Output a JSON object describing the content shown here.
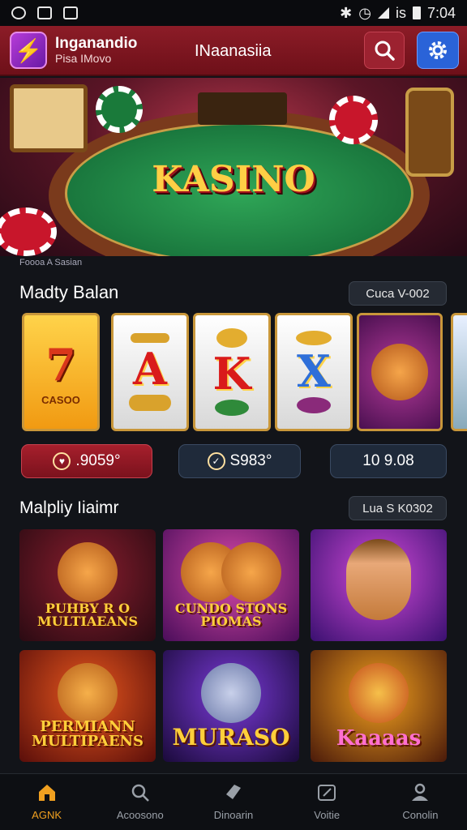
{
  "status_bar": {
    "time": "7:04",
    "network": "is"
  },
  "header": {
    "brand_line1": "Inganandio",
    "brand_line2": "Pisa IMovo",
    "title": "INaanasiia"
  },
  "hero": {
    "word": "KASINO",
    "caption": "Foooa A Sasian"
  },
  "section1": {
    "title": "Madty Balan",
    "pill": "Cuca V-002",
    "reels": [
      {
        "symbol": "7",
        "sub": "CASOO"
      },
      {
        "symbol": "A",
        "sub": ""
      },
      {
        "symbol": "K",
        "sub": ""
      },
      {
        "symbol": "X",
        "sub": ""
      },
      {
        "symbol": "",
        "sub": ""
      }
    ],
    "stats": [
      {
        "value": ".9059°",
        "icon": "heart-icon"
      },
      {
        "value": "S983°",
        "icon": "check-circle-icon"
      },
      {
        "value": "10 9.08",
        "icon": ""
      }
    ]
  },
  "section2": {
    "title": "Malpliy Iiaimr",
    "pill": "Lua S K0302",
    "games": [
      {
        "name": "PUHBY R O MULTIAEANS"
      },
      {
        "name": "CUNDO STONS PIOMAS"
      },
      {
        "name": ""
      },
      {
        "name": "PERMIANN MULTIPAENS"
      },
      {
        "name": "MURASO"
      },
      {
        "name": "Kaaaas"
      }
    ]
  },
  "nav": [
    {
      "label": "AGNK",
      "icon": "home-icon"
    },
    {
      "label": "Acoosono",
      "icon": "search-icon"
    },
    {
      "label": "Dinoarin",
      "icon": "tag-icon"
    },
    {
      "label": "Voitie",
      "icon": "edit-icon"
    },
    {
      "label": "Conolin",
      "icon": "user-icon"
    }
  ],
  "colors": {
    "accent": "#8c1c27",
    "highlight": "#f0a020",
    "settings": "#2a63d8"
  }
}
